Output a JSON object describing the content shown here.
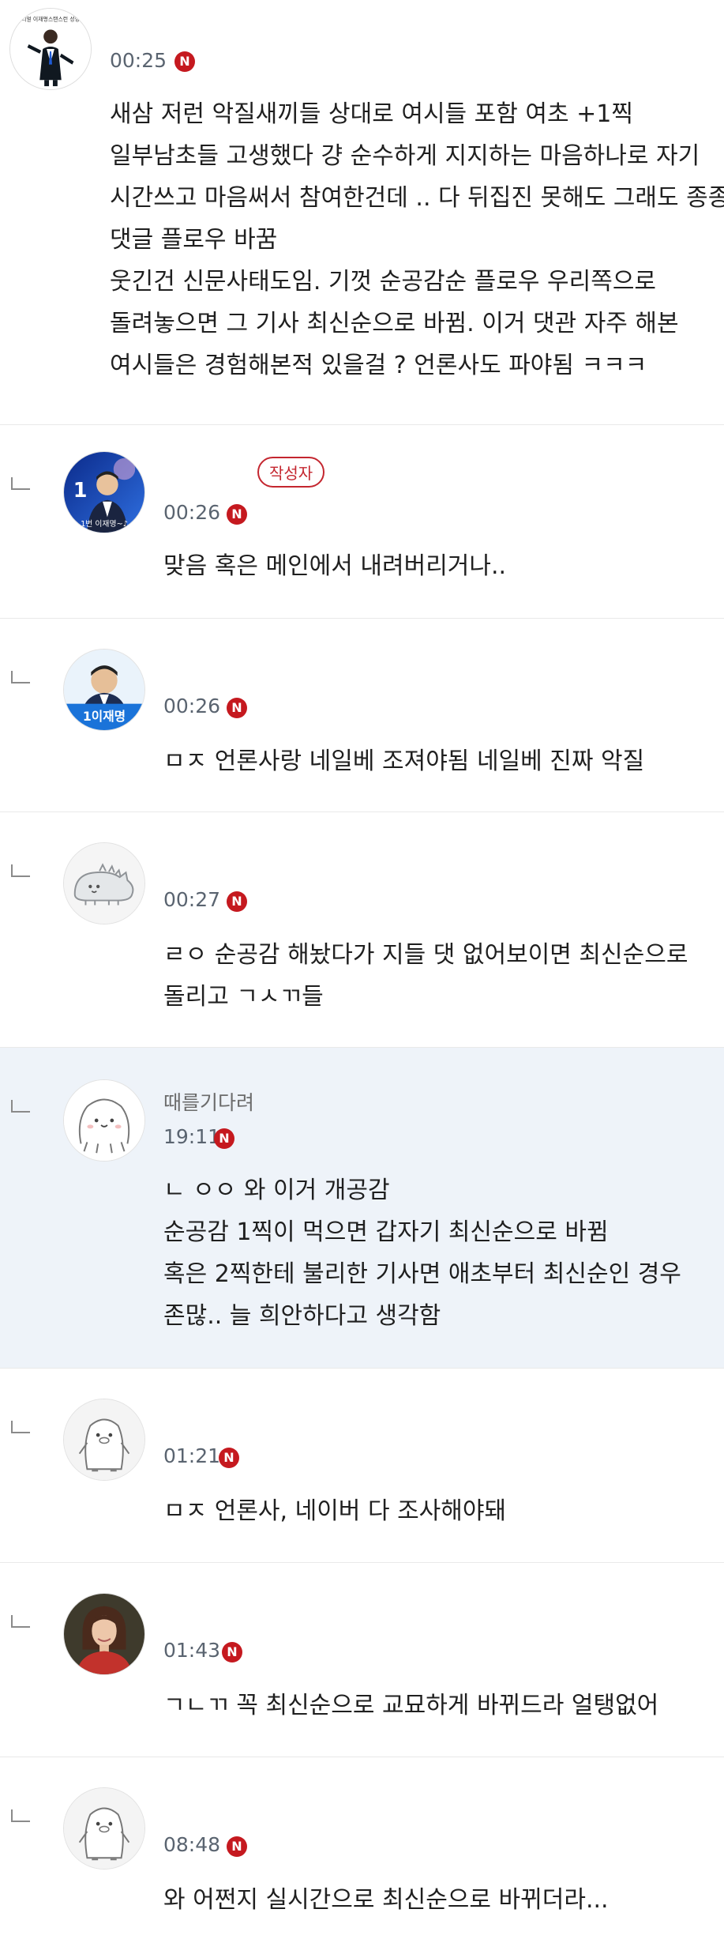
{
  "badges": {
    "new_marker": "N",
    "author_label": "작성자"
  },
  "comments": [
    {
      "nickname": "",
      "time": "00:25",
      "avatar": "poster-icon",
      "avatar_text": "리얼 이재명스탠스런 성향",
      "lines": [
        "새삼 저런 악질새끼들 상대로 여시들 포함 여초 +1찍",
        "일부남초들 고생했다 걍 순수하게 지지하는 마음하나로 자기",
        "시간쓰고 마음써서 참여한건데 .. 다 뒤집진 못해도 그래도 종종",
        "댓글 플로우 바꿈",
        "웃긴건 신문사태도임. 기껏 순공감순 플로우 우리쪽으로",
        "돌려놓으면 그 기사 최신순으로 바뀜. 이거 댓관 자주 해본",
        "여시들은 경험해본적 있을걸 ? 언론사도 파야됨 ㅋㅋㅋ"
      ]
    },
    {
      "nickname": "",
      "time": "00:26",
      "avatar": "candidate-icon",
      "avatar_text": "1번 이재명~♪",
      "lines": [
        "맞음 혹은 메인에서 내려버리거나.."
      ]
    },
    {
      "nickname": "",
      "time": "00:26",
      "avatar": "candidate-icon",
      "avatar_text": "1이재명",
      "lines": [
        "ㅁㅈ 언론사랑 네일베 조져야됨 네일베 진짜 악질"
      ]
    },
    {
      "nickname": "",
      "time": "00:27",
      "avatar": "dino-icon",
      "lines": [
        "ㄹㅇ 순공감 해놨다가 지들 댓 없어보이면 최신순으로",
        "돌리고 ㄱㅅㄲ들"
      ]
    },
    {
      "nickname": "때를기다려",
      "time": "19:11",
      "avatar": "blob-icon",
      "lines": [
        "ㄴ ㅇㅇ 와 이거 개공감",
        "순공감 1찍이 먹으면 갑자기 최신순으로 바뀜",
        "혹은 2찍한테 불리한 기사면 애초부터 최신순인 경우",
        "존많.. 늘 희안하다고 생각함"
      ]
    },
    {
      "nickname": "",
      "time": "01:21",
      "avatar": "penguin-icon",
      "lines": [
        "ㅁㅈ 언론사, 네이버 다 조사해야돼"
      ]
    },
    {
      "nickname": "",
      "time": "01:43",
      "avatar": "woman-photo-icon",
      "lines": [
        "ㄱㄴㄲ 꼭 최신순으로 교묘하게 바뀌드라 얼탱없어"
      ]
    },
    {
      "nickname": "",
      "time": "08:48",
      "avatar": "penguin-icon",
      "lines": [
        "와 어쩐지 실시간으로 최신순으로 바뀌더라..."
      ]
    }
  ]
}
